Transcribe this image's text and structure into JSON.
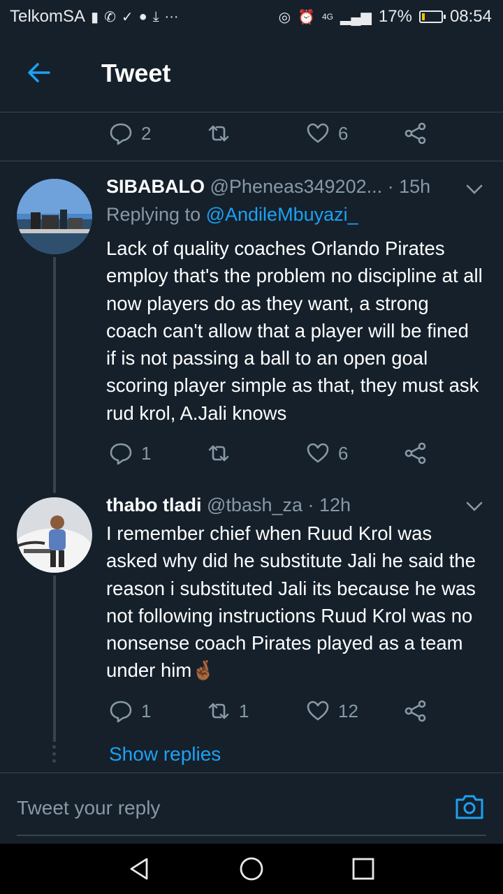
{
  "status_bar": {
    "carrier": "TelkomSA",
    "network": "4G",
    "battery": "17%",
    "battery_level": 0.17,
    "time": "08:54",
    "battery_color": "#f2c200"
  },
  "app_bar": {
    "title": "Tweet"
  },
  "top_actions": {
    "reply_count": "2",
    "retweet_count": "",
    "like_count": "6"
  },
  "tweets": [
    {
      "name": "SIBABALO",
      "handle": "@Pheneas349202...",
      "time": "· 15h",
      "replying_label": "Replying to",
      "replying_handle": "@AndileMbuyazi_",
      "text": "Lack of quality coaches Orlando Pirates employ that's the problem no discipline at all now players do as they want, a strong coach can't allow that a player will be fined if is not passing a ball to an open goal scoring player simple as that, they must ask rud krol, A.Jali knows",
      "reply_count": "1",
      "retweet_count": "",
      "like_count": "6"
    },
    {
      "name": "thabo tladi",
      "handle": "@tbash_za",
      "time": "· 12h",
      "text": "I remember chief when Ruud Krol was asked why did he substitute Jali he said the reason i substituted Jali its because he was not following instructions Ruud Krol was no nonsense coach Pirates played as a team under him🤞🏾",
      "reply_count": "1",
      "retweet_count": "1",
      "like_count": "12"
    }
  ],
  "show_replies": "Show replies",
  "composer": {
    "placeholder": "Tweet your reply"
  },
  "colors": {
    "background": "#15202b",
    "accent": "#1da1f2",
    "muted": "#8899a6",
    "divider": "#38444d"
  },
  "icons": [
    "back-arrow-icon",
    "reply-icon",
    "retweet-icon",
    "like-icon",
    "share-icon",
    "chevron-down-icon",
    "camera-icon",
    "nav-back-icon",
    "nav-home-icon",
    "nav-recents-icon"
  ]
}
